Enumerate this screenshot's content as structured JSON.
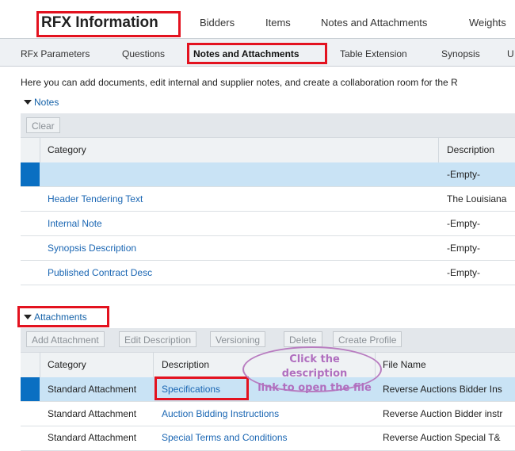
{
  "main_tabs": {
    "active": "RFX Information",
    "items": [
      "Bidders",
      "Items",
      "Notes and Attachments",
      "Weights"
    ]
  },
  "sub_tabs": {
    "items": [
      "RFx Parameters",
      "Questions",
      "Notes and Attachments",
      "Table Extension",
      "Synopsis",
      "U"
    ]
  },
  "intro_text": "Here you can add documents, edit internal and supplier notes, and create a collaboration room for the R",
  "notes": {
    "section_label": "Notes",
    "clear_button": "Clear",
    "columns": [
      "Category",
      "Description"
    ],
    "rows": [
      {
        "category": "",
        "description": "-Empty-"
      },
      {
        "category": "Header Tendering Text",
        "description": "The Louisiana"
      },
      {
        "category": "Internal Note",
        "description": "-Empty-"
      },
      {
        "category": "Synopsis Description",
        "description": "-Empty-"
      },
      {
        "category": "Published Contract Desc",
        "description": "-Empty-"
      }
    ]
  },
  "attachments": {
    "section_label": "Attachments",
    "toolbar": [
      "Add Attachment",
      "Edit Description",
      "Versioning",
      "Delete",
      "Create Profile"
    ],
    "columns": [
      "Category",
      "Description",
      "File Name"
    ],
    "rows": [
      {
        "category": "Standard Attachment",
        "description": "Specifications",
        "file_name": "Reverse Auctions Bidder Ins"
      },
      {
        "category": "Standard Attachment",
        "description": "Auction Bidding Instructions",
        "file_name": "Reverse Auction Bidder instr"
      },
      {
        "category": "Standard Attachment",
        "description": "Special Terms and Conditions",
        "file_name": "Reverse Auction Special T&"
      }
    ]
  },
  "callout": {
    "line1": "Click the description",
    "line2": "link to open the file"
  },
  "colors": {
    "highlight_red": "#e3121f",
    "selection_blue": "#0a6fc2",
    "link_blue": "#1a66b3",
    "callout_purple": "#b87cc0"
  }
}
